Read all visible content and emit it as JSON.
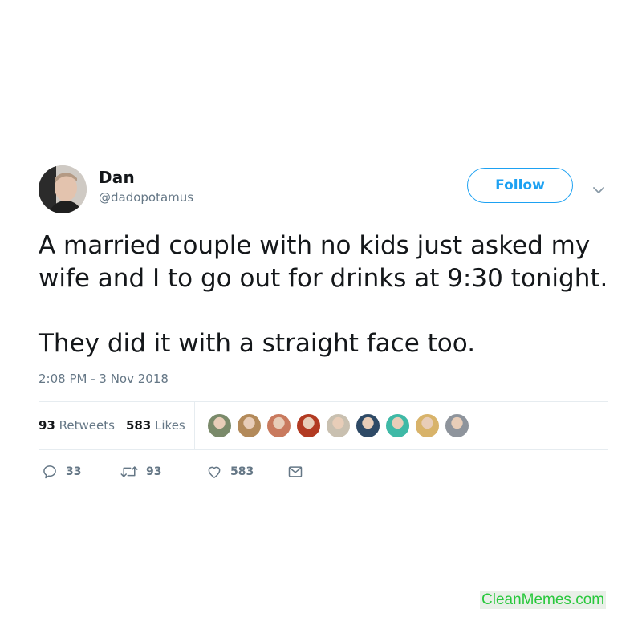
{
  "author": {
    "name": "Dan",
    "handle": "@dadopotamus",
    "avatar_icon": "profile-photo"
  },
  "follow_button": {
    "label": "Follow"
  },
  "menu": {
    "icon": "chevron-down-icon"
  },
  "tweet": {
    "paragraphs": [
      "A married couple with no kids just asked my wife and I to go out for drinks at 9:30 tonight.",
      "They did it with a straight face too."
    ],
    "timestamp": "2:08 PM - 3 Nov 2018"
  },
  "stats": {
    "retweets_count": "93",
    "retweets_label": "Retweets",
    "likes_count": "583",
    "likes_label": "Likes"
  },
  "likers": [
    {
      "name": "liker-1",
      "color": "#7a8a6a"
    },
    {
      "name": "liker-2",
      "color": "#b38a5a"
    },
    {
      "name": "liker-3",
      "color": "#c97a5e"
    },
    {
      "name": "liker-4",
      "color": "#b23a22"
    },
    {
      "name": "liker-5",
      "color": "#c9c0b0"
    },
    {
      "name": "liker-6",
      "color": "#2e4a66"
    },
    {
      "name": "liker-7",
      "color": "#3fb9a6"
    },
    {
      "name": "liker-8",
      "color": "#d8b36a"
    },
    {
      "name": "liker-9",
      "color": "#8e949c"
    }
  ],
  "actions": {
    "reply_count": "33",
    "retweet_count": "93",
    "like_count": "583"
  },
  "watermark": {
    "text": "CleanMemes.com"
  },
  "colors": {
    "accent": "#1da1f2",
    "muted": "#657786",
    "watermark_text": "#28c83c"
  }
}
